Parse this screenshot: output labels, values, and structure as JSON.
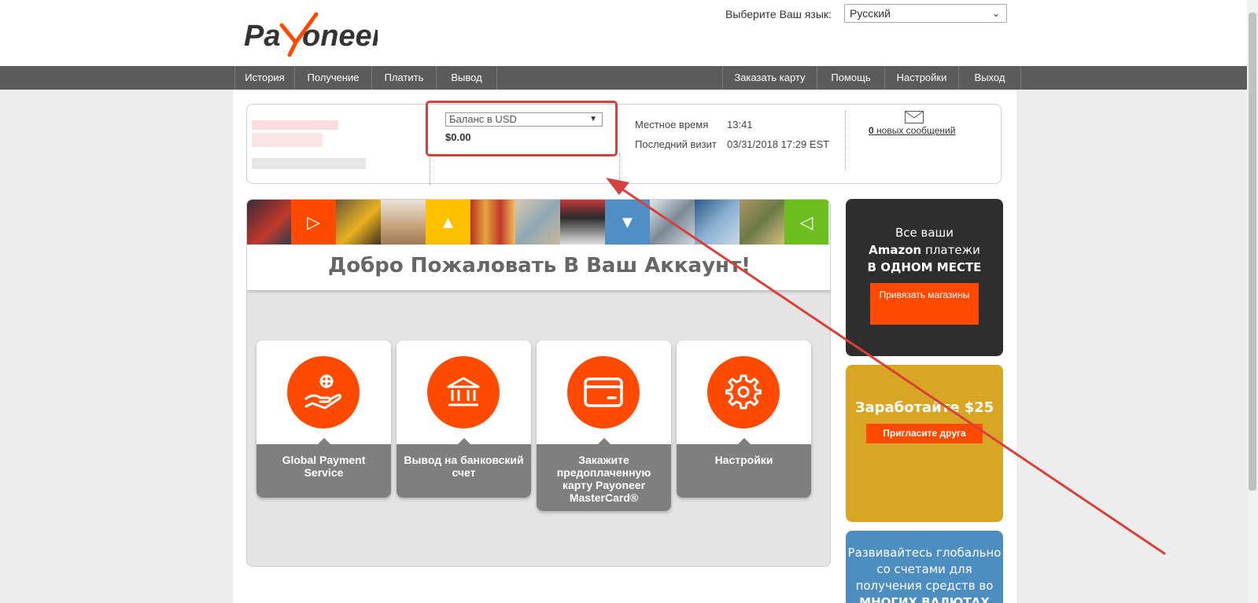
{
  "header": {
    "logo_text": "Payoneer",
    "lang_label": "Выберите Ваш язык:",
    "lang_selected": "Русский"
  },
  "nav": {
    "left": [
      "История",
      "Получение",
      "Платить",
      "Вывод"
    ],
    "right": [
      "Заказать карту",
      "Помощь",
      "Настройки",
      "Выход"
    ]
  },
  "account": {
    "balance_select": "Баланс в USD",
    "balance_amount": "$0.00",
    "local_time_label": "Местное время",
    "local_time_value": "13:41",
    "last_visit_label": "Последний визит",
    "last_visit_value": "03/31/2018 17:29 EST",
    "messages_count": "0",
    "messages_text": "новых сообщений"
  },
  "welcome": {
    "title": "Добро Пожаловать В Ваш Аккаунт!",
    "cards": [
      {
        "label": "Global Payment Service",
        "icon": "hand-globe-icon"
      },
      {
        "label": "Вывод на банковский счет",
        "icon": "bank-icon"
      },
      {
        "label": "Закажите предоплаченную карту Payoneer MasterCard®",
        "icon": "card-icon"
      },
      {
        "label": "Настройки",
        "icon": "gear-icon"
      }
    ]
  },
  "promos": {
    "amazon": {
      "line1": "Все ваши",
      "line2a": "Amazon",
      "line2b": "платежи",
      "line3": "В ОДНОМ МЕСТЕ",
      "button": "Привязать магазины"
    },
    "referral": {
      "title": "Заработайте $25",
      "button": "Пригласите друга"
    },
    "global": {
      "text": "Развивайтесь глобально со счетами для получения средств во",
      "bold": "МНОГИХ ВАЛЮТАХ"
    }
  },
  "colors": {
    "brand_orange": "#ff4a00",
    "nav_bg": "#5b5b5b",
    "annotation_red": "#d8403c"
  }
}
